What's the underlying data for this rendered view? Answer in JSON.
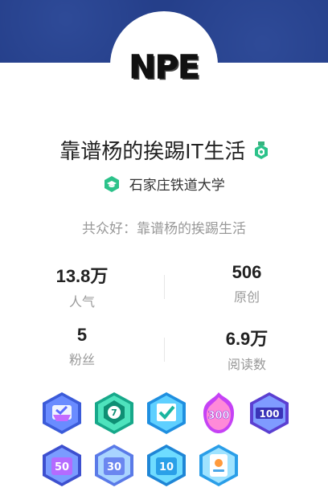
{
  "profile": {
    "avatar_text": "NPE",
    "name": "靠谱杨的挨踢IT生活",
    "school": "石家庄铁道大学",
    "motto": "共众好：靠谱杨的挨踢生活"
  },
  "stats": [
    {
      "value": "13.8万",
      "label": "人气"
    },
    {
      "value": "506",
      "label": "原创"
    },
    {
      "value": "5",
      "label": "粉丝"
    },
    {
      "value": "6.9万",
      "label": "阅读数"
    }
  ],
  "badges": [
    {
      "icon": "checklist-medal-icon",
      "text": ""
    },
    {
      "icon": "seven-medal-icon",
      "text": "7"
    },
    {
      "icon": "check-medal-icon",
      "text": ""
    },
    {
      "icon": "fire-300-medal-icon",
      "text": "300"
    },
    {
      "icon": "hundred-medal-icon",
      "text": "100"
    },
    {
      "icon": "fifty-medal-icon",
      "text": "50"
    },
    {
      "icon": "thirty-medal-icon",
      "text": "30"
    },
    {
      "icon": "ten-medal-icon",
      "text": "10"
    },
    {
      "icon": "id-card-medal-icon",
      "text": ""
    }
  ],
  "colors": {
    "banner": "#253f8a",
    "accent_green": "#2cc28a",
    "muted": "#999999"
  }
}
